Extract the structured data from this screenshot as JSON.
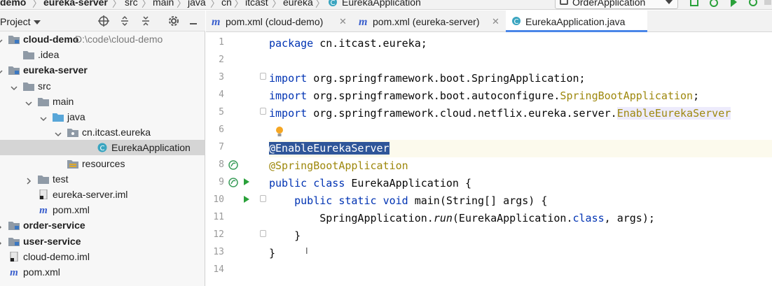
{
  "breadcrumb": [
    "demo",
    "eureka-server",
    "src",
    "main",
    "java",
    "cn",
    "itcast",
    "eureka",
    "EurekaApplication"
  ],
  "run_config": {
    "label": "OrderApplication"
  },
  "project_panel": {
    "title": "Project",
    "tree": [
      {
        "label": "cloud-demo",
        "path": "D:\\code\\cloud-demo",
        "bold": true,
        "icon": "module-folder-icon",
        "indent": 0,
        "chevron": "down"
      },
      {
        "label": ".idea",
        "icon": "folder-icon",
        "indent": 1,
        "chevron": "none"
      },
      {
        "label": "eureka-server",
        "bold": true,
        "icon": "module-folder-icon",
        "indent": 0,
        "chevron": "down"
      },
      {
        "label": "src",
        "icon": "folder-icon",
        "indent": 1,
        "chevron": "down"
      },
      {
        "label": "main",
        "icon": "folder-icon",
        "indent": 2,
        "chevron": "down"
      },
      {
        "label": "java",
        "icon": "source-folder-icon",
        "indent": 3,
        "chevron": "down"
      },
      {
        "label": "cn.itcast.eureka",
        "icon": "package-icon",
        "indent": 4,
        "chevron": "down"
      },
      {
        "label": "EurekaApplication",
        "icon": "spring-class-icon",
        "indent": 6,
        "chevron": "none",
        "selected": true
      },
      {
        "label": "resources",
        "icon": "resources-folder-icon",
        "indent": 4,
        "chevron": "none"
      },
      {
        "label": "test",
        "icon": "folder-icon",
        "indent": 2,
        "chevron": "right"
      },
      {
        "label": "eureka-server.iml",
        "icon": "iml-file-icon",
        "indent": 2,
        "chevron": "none"
      },
      {
        "label": "pom.xml",
        "icon": "maven-icon",
        "indent": 2,
        "chevron": "none"
      },
      {
        "label": "order-service",
        "bold": true,
        "icon": "module-folder-icon",
        "indent": 0,
        "chevron": "right"
      },
      {
        "label": "user-service",
        "bold": true,
        "icon": "module-folder-icon",
        "indent": 0,
        "chevron": "right"
      },
      {
        "label": "cloud-demo.iml",
        "icon": "iml-file-icon",
        "indent": 0,
        "chevron": "none"
      },
      {
        "label": "pom.xml",
        "icon": "maven-icon",
        "indent": 0,
        "chevron": "none"
      }
    ]
  },
  "tabs": [
    {
      "label": "pom.xml (cloud-demo)",
      "icon": "maven-icon",
      "active": false
    },
    {
      "label": "pom.xml (eureka-server)",
      "icon": "maven-icon",
      "active": false
    },
    {
      "label": "EurekaApplication.java",
      "icon": "spring-class-icon",
      "active": true
    }
  ],
  "editor": {
    "line_numbers": [
      "1",
      "2",
      "3",
      "4",
      "5",
      "6",
      "7",
      "8",
      "9",
      "10",
      "11",
      "12",
      "13",
      "14"
    ],
    "code": {
      "l1_kw": "package",
      "l1_rest": " cn.itcast.eureka;",
      "l3_kw": "import",
      "l3_rest": " org.springframework.boot.SpringApplication;",
      "l4_kw": "import",
      "l4_rest": " org.springframework.boot.autoconfigure.",
      "l4_type": "SpringBootApplication",
      "l4_end": ";",
      "l5_kw": "import",
      "l5_rest": " org.springframework.cloud.netflix.eureka.server.",
      "l5_type": "EnableEurekaServer",
      "l7_ann": "@EnableEurekaServer",
      "l8_ann": "@SpringBootApplication",
      "l9_kw1": "public",
      "l9_kw2": "class",
      "l9_rest": " EurekaApplication {",
      "l10_indent": "    ",
      "l10_kw1": "public",
      "l10_kw2": "static",
      "l10_kw3": "void",
      "l10_rest": " main(String[] args) {",
      "l11_indent": "        ",
      "l11_a": "SpringApplication.",
      "l11_call": "run",
      "l11_b": "(EurekaApplication.",
      "l11_kw": "class",
      "l11_c": ", args);",
      "l12_text": "    }",
      "l13_text": "}"
    },
    "colors": {
      "keyword": "#0033b3",
      "annotation": "#9e880d",
      "selection": "#2f5699",
      "run_arrow": "#2aa13a"
    }
  }
}
